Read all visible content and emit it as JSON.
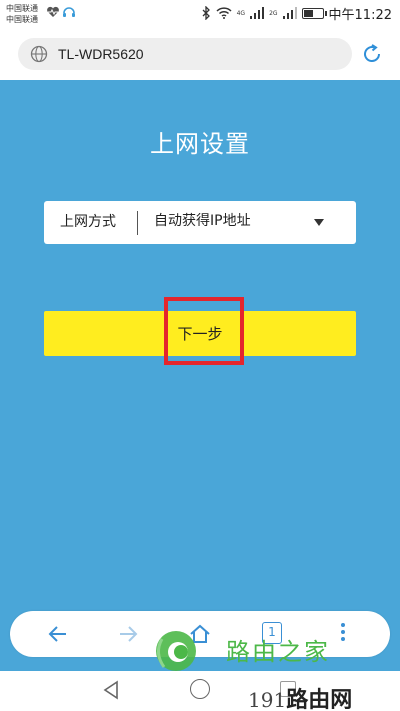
{
  "status_bar": {
    "carrier_1": "中国联通",
    "carrier_2": "中国联通",
    "network_1": "4G",
    "network_2": "2G",
    "time": "中午11:22"
  },
  "address_bar": {
    "url": "TL-WDR5620"
  },
  "page": {
    "title": "上网设置",
    "connection_type_label": "上网方式",
    "connection_type_value": "自动获得IP地址",
    "next_button_label": "下一步"
  },
  "browser_nav": {
    "tab_count": "1"
  },
  "watermark": {
    "logo_text": "路由之家",
    "site_prefix": "191",
    "site_name": "路由网"
  },
  "colors": {
    "page_background": "#4aa6d8",
    "button_yellow": "#ffed1f",
    "highlight_red": "#e4262c",
    "nav_blue": "#3a8fd4"
  }
}
